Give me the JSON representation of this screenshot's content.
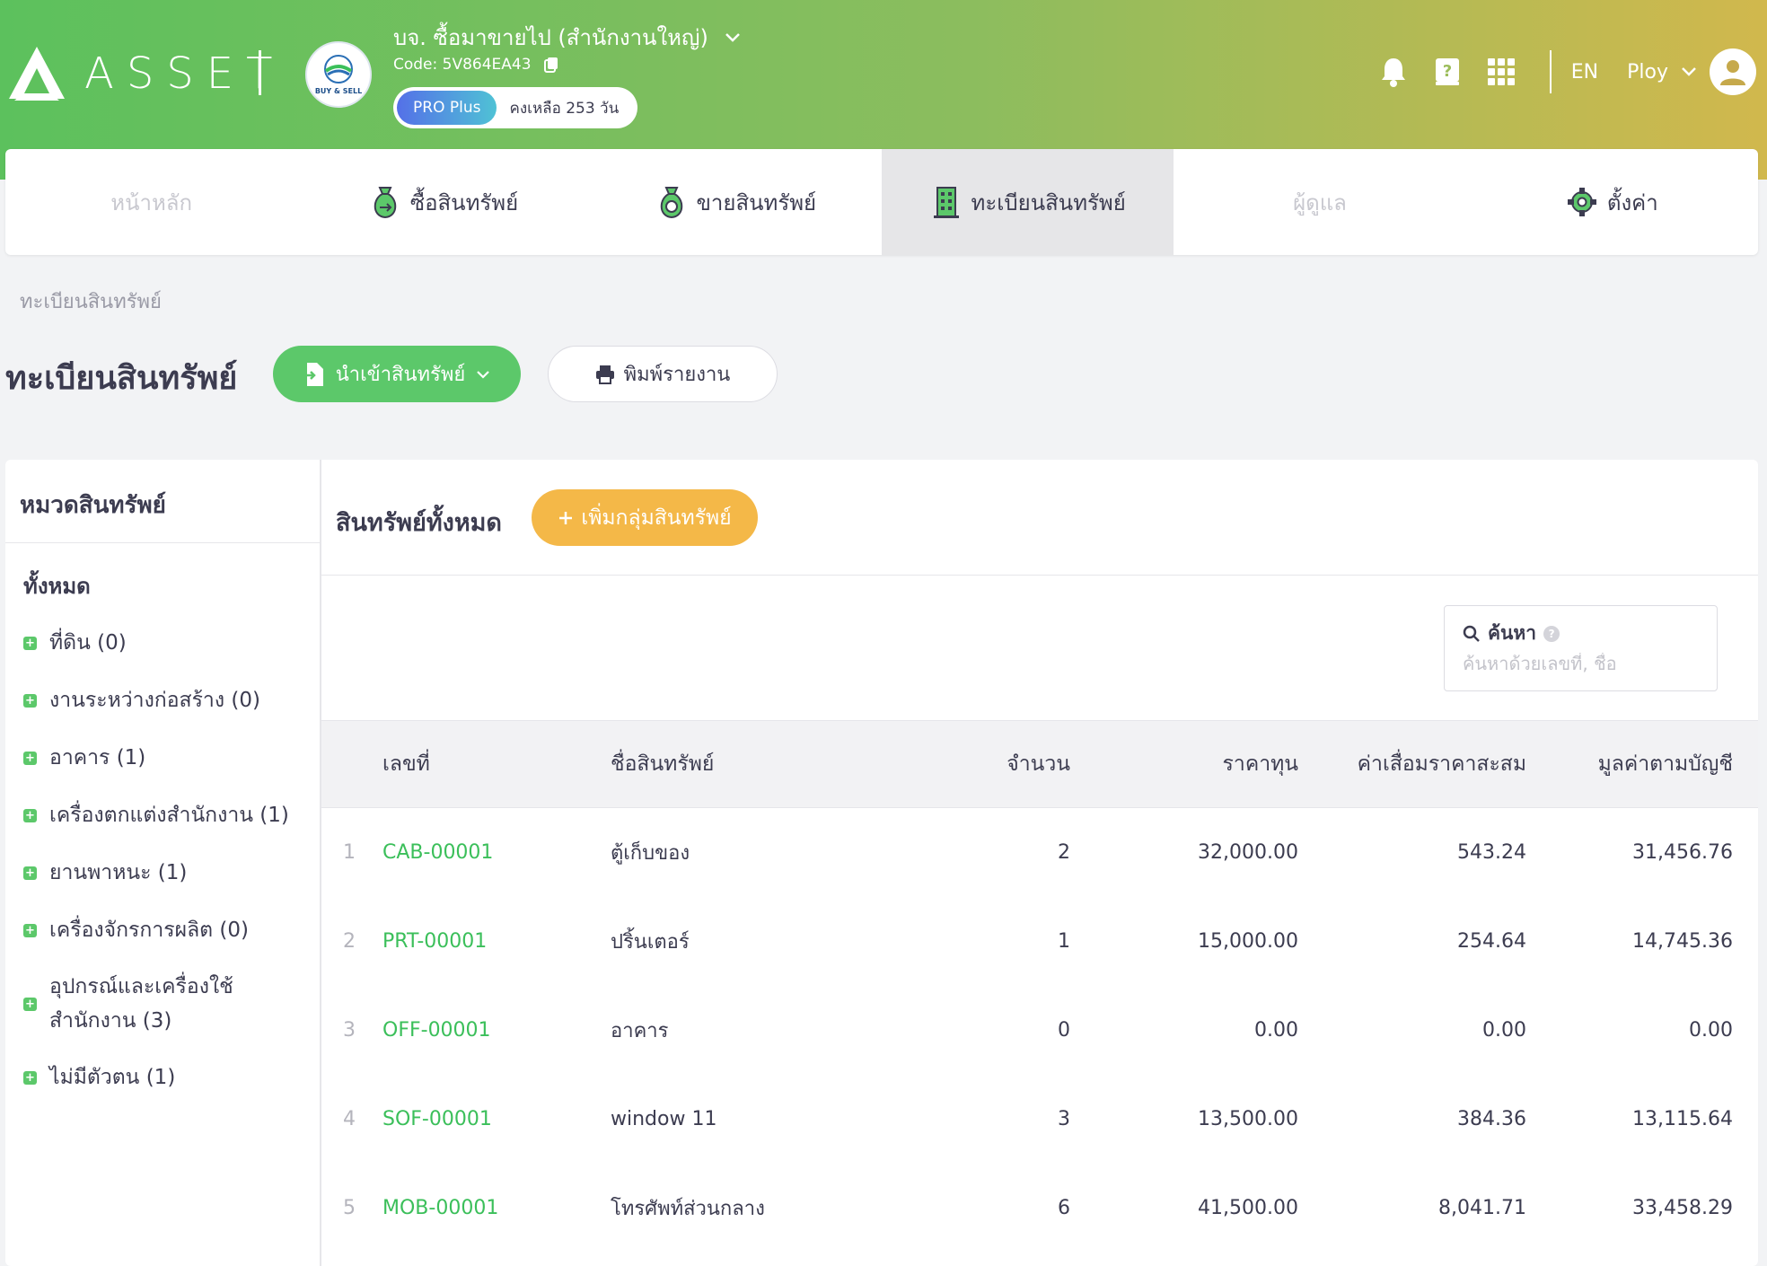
{
  "app": {
    "logo_text": "ASSET",
    "company_name": "บจ. ซื้อมาขายไป (สำนักงานใหญ่)",
    "company_code": "Code: 5V864EA43",
    "company_logo_text": "BUY & SELL",
    "plan": "PRO Plus",
    "plan_remaining": "คงเหลือ 253 วัน",
    "language": "EN",
    "user_name": "Ploy"
  },
  "colors": {
    "brand_green": "#5cc86a",
    "header_gradient_start": "#5cc15d",
    "header_gradient_end": "#d1b84d",
    "accent_orange": "#f4b848",
    "link_green": "#3bbf5a"
  },
  "nav": {
    "items": [
      {
        "label": "หน้าหลัก",
        "icon": "",
        "state": "disabled"
      },
      {
        "label": "ซื้อสินทรัพย์",
        "icon": "money-bag-icon",
        "state": "normal"
      },
      {
        "label": "ขายสินทรัพย์",
        "icon": "money-bag-icon",
        "state": "normal"
      },
      {
        "label": "ทะเบียนสินทรัพย์",
        "icon": "building-icon",
        "state": "active"
      },
      {
        "label": "ผู้ดูแล",
        "icon": "",
        "state": "disabled"
      },
      {
        "label": "ตั้งค่า",
        "icon": "gear-icon",
        "state": "normal"
      }
    ]
  },
  "page": {
    "breadcrumb": "ทะเบียนสินทรัพย์",
    "title": "ทะเบียนสินทรัพย์",
    "import_button": "นำเข้าสินทรัพย์",
    "print_button": "พิมพ์รายงาน"
  },
  "categories": {
    "title": "หมวดสินทรัพย์",
    "all_label": "ทั้งหมด",
    "items": [
      {
        "label": "ที่ดิน (0)"
      },
      {
        "label": "งานระหว่างก่อสร้าง (0)"
      },
      {
        "label": "อาคาร (1)"
      },
      {
        "label": "เครื่องตกแต่งสำนักงาน (1)"
      },
      {
        "label": "ยานพาหนะ (1)"
      },
      {
        "label": "เครื่องจักรการผลิต (0)"
      },
      {
        "label": "อุปกรณ์และเครื่องใช้ สำนักงาน (3)"
      },
      {
        "label": "ไม่มีตัวตน (1)"
      }
    ]
  },
  "content": {
    "title": "สินทรัพย์ทั้งหมด",
    "add_group_button": "เพิ่มกลุ่มสินทรัพย์",
    "search_label": "ค้นหา",
    "search_help": "?",
    "search_placeholder": "ค้นหาด้วยเลขที่, ชื่อ"
  },
  "table": {
    "headers": {
      "code": "เลขที่",
      "name": "ชื่อสินทรัพย์",
      "qty": "จำนวน",
      "cost": "ราคาทุน",
      "depreciation": "ค่าเสื่อมราคาสะสม",
      "book_value": "มูลค่าตามบัญชี"
    },
    "rows": [
      {
        "idx": "1",
        "code": "CAB-00001",
        "name": "ตู้เก็บของ",
        "qty": "2",
        "cost": "32,000.00",
        "depreciation": "543.24",
        "book_value": "31,456.76"
      },
      {
        "idx": "2",
        "code": "PRT-00001",
        "name": "ปริ้นเตอร์",
        "qty": "1",
        "cost": "15,000.00",
        "depreciation": "254.64",
        "book_value": "14,745.36"
      },
      {
        "idx": "3",
        "code": "OFF-00001",
        "name": "อาคาร",
        "qty": "0",
        "cost": "0.00",
        "depreciation": "0.00",
        "book_value": "0.00"
      },
      {
        "idx": "4",
        "code": "SOF-00001",
        "name": "window 11",
        "qty": "3",
        "cost": "13,500.00",
        "depreciation": "384.36",
        "book_value": "13,115.64"
      },
      {
        "idx": "5",
        "code": "MOB-00001",
        "name": "โทรศัพท์ส่วนกลาง",
        "qty": "6",
        "cost": "41,500.00",
        "depreciation": "8,041.71",
        "book_value": "33,458.29"
      }
    ]
  }
}
